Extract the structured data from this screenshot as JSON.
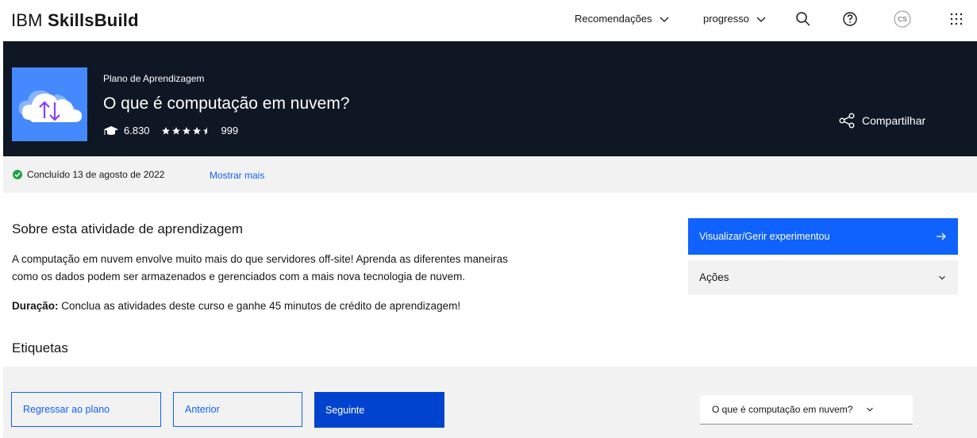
{
  "header": {
    "brand_prefix": "IBM",
    "brand_name": "SkillsBuild",
    "nav_recommendations": "Recomendações",
    "nav_progress": "progresso",
    "avatar_initials": "CS"
  },
  "hero": {
    "kicker": "Plano de Aprendizagem",
    "title": "O que é computação em nuvem?",
    "learners": "6.830",
    "rating": 4.5,
    "rating_count": "999",
    "share_label": "Compartilhar"
  },
  "status": {
    "completed": "Concluído 13 de agosto de 2022",
    "show_more": "Mostrar mais"
  },
  "about": {
    "title": "Sobre esta atividade de aprendizagem",
    "description_line1": "A computação em nuvem envolve muito mais do que servidores off-site! Aprenda as diferentes maneiras",
    "description_line2": "como os dados podem ser armazenados e gerenciados com a mais nova tecnologia de nuvem.",
    "duration_label": "Duração:",
    "duration_text": " Conclua as atividades deste curso e ganhe 45 minutos de crédito de aprendizagem!",
    "tags_title": "Etiquetas"
  },
  "side": {
    "cta_label": "Visualizar/Gerir experimentou",
    "actions_label": "Ações"
  },
  "footer": {
    "back_label": "Regressar ao plano",
    "prev_label": "Anterior",
    "next_label": "Seguinte",
    "activity_select": "O que é computação em nuvem?"
  },
  "colors": {
    "accent": "#0f62fe",
    "hero_bg": "#0f1724",
    "success": "#24a148"
  }
}
